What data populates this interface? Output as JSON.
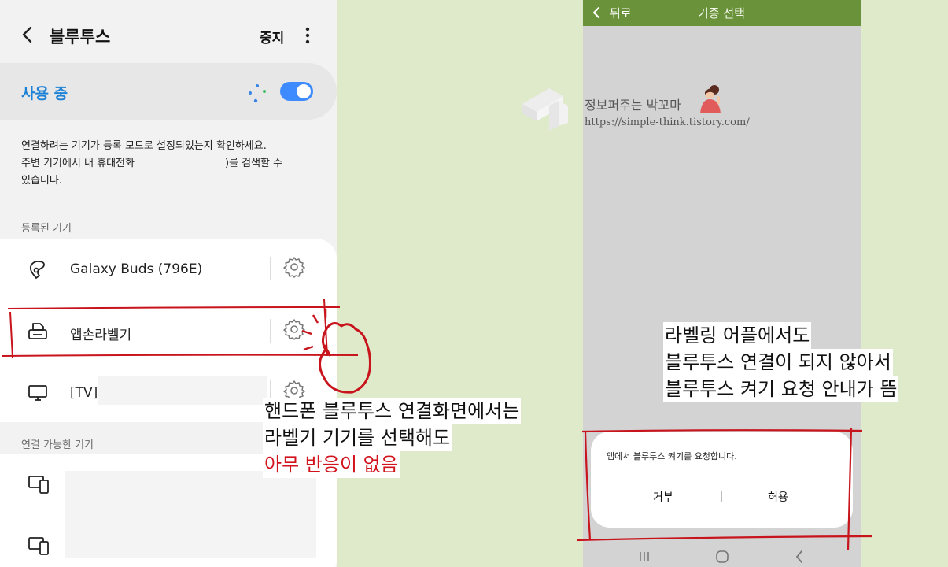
{
  "settings": {
    "title": "블루투스",
    "stop_label": "중지",
    "status_label": "사용 중",
    "description_line1": "연결하려는 기기가 등록 모드로 설정되었는지 확인하세요.",
    "description_line2_a": "주변 기기에서 내 휴대전화",
    "description_line2_b": ")를 검색할 수",
    "description_line3": "있습니다.",
    "registered_header": "등록된 기기",
    "registered_devices": [
      {
        "name": "Galaxy Buds (796E)",
        "icon": "earbuds-icon"
      },
      {
        "name": "앱손라벨기",
        "icon": "printer-icon"
      },
      {
        "name": "[TV]",
        "icon": "tv-icon"
      }
    ],
    "available_header": "연결 가능한 기기",
    "available_devices": [
      {
        "icon": "tablet-phone-icon"
      },
      {
        "icon": "tablet-phone-icon"
      }
    ]
  },
  "phone": {
    "back_label": "뒤로",
    "title": "기종 선택",
    "dialog": {
      "message": "앱에서 블루투스 켜기를 요청합니다.",
      "deny_label": "거부",
      "allow_label": "허용"
    }
  },
  "watermark": {
    "name": "정보퍼주는 박꼬마",
    "url": "https://simple-think.tistory.com/"
  },
  "captions": {
    "left_line1": "핸드폰 블루투스 연결화면에서는",
    "left_line2": "라벨기 기기를 선택해도",
    "left_line3": "아무 반응이 없음",
    "right_line1": "라벨링 어플에서도",
    "right_line2": "블루투스 연결이 되지 않아서",
    "right_line3": "블루투스 켜기 요청 안내가 뜸"
  },
  "colors": {
    "accent_blue": "#1e82d6",
    "toggle_blue": "#3d8bff",
    "phone_bar_green": "#6a923a",
    "annotation_red": "#c8141c",
    "background_green": "#dfeacb"
  }
}
